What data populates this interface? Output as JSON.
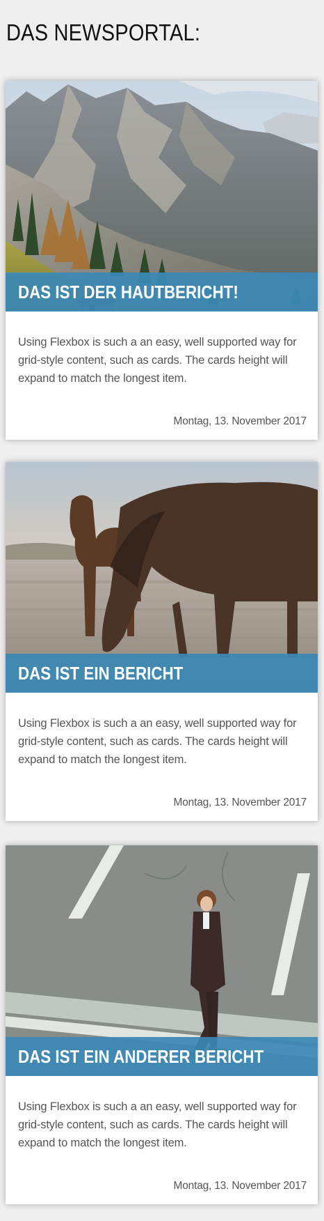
{
  "page": {
    "title": "DAS NEWSPORTAL:"
  },
  "colors": {
    "background": "#efefef",
    "headline_band": "#3b89b5",
    "headline_text": "#ffffff",
    "body_text": "#555555"
  },
  "cards": [
    {
      "image": "mountain-valley-photo",
      "headline": "DAS IST DER HAUTBERICHT!",
      "text": "Using Flexbox is such a an easy, well supported way for grid-style content, such as cards. The cards height will expand to match the longest item.",
      "date": "Montag, 13. November 2017"
    },
    {
      "image": "horses-grazing-photo",
      "headline": "DAS IST EIN BERICHT",
      "text": "Using Flexbox is such a an easy, well supported way for grid-style content, such as cards. The cards height will expand to match the longest item.",
      "date": "Montag, 13. November 2017"
    },
    {
      "image": "man-walking-street-photo",
      "headline": "DAS IST EIN ANDERER BERICHT",
      "text": "Using Flexbox is such a an easy, well supported way for grid-style content, such as cards. The cards height will expand to match the longest item.",
      "date": "Montag, 13. November 2017"
    }
  ]
}
